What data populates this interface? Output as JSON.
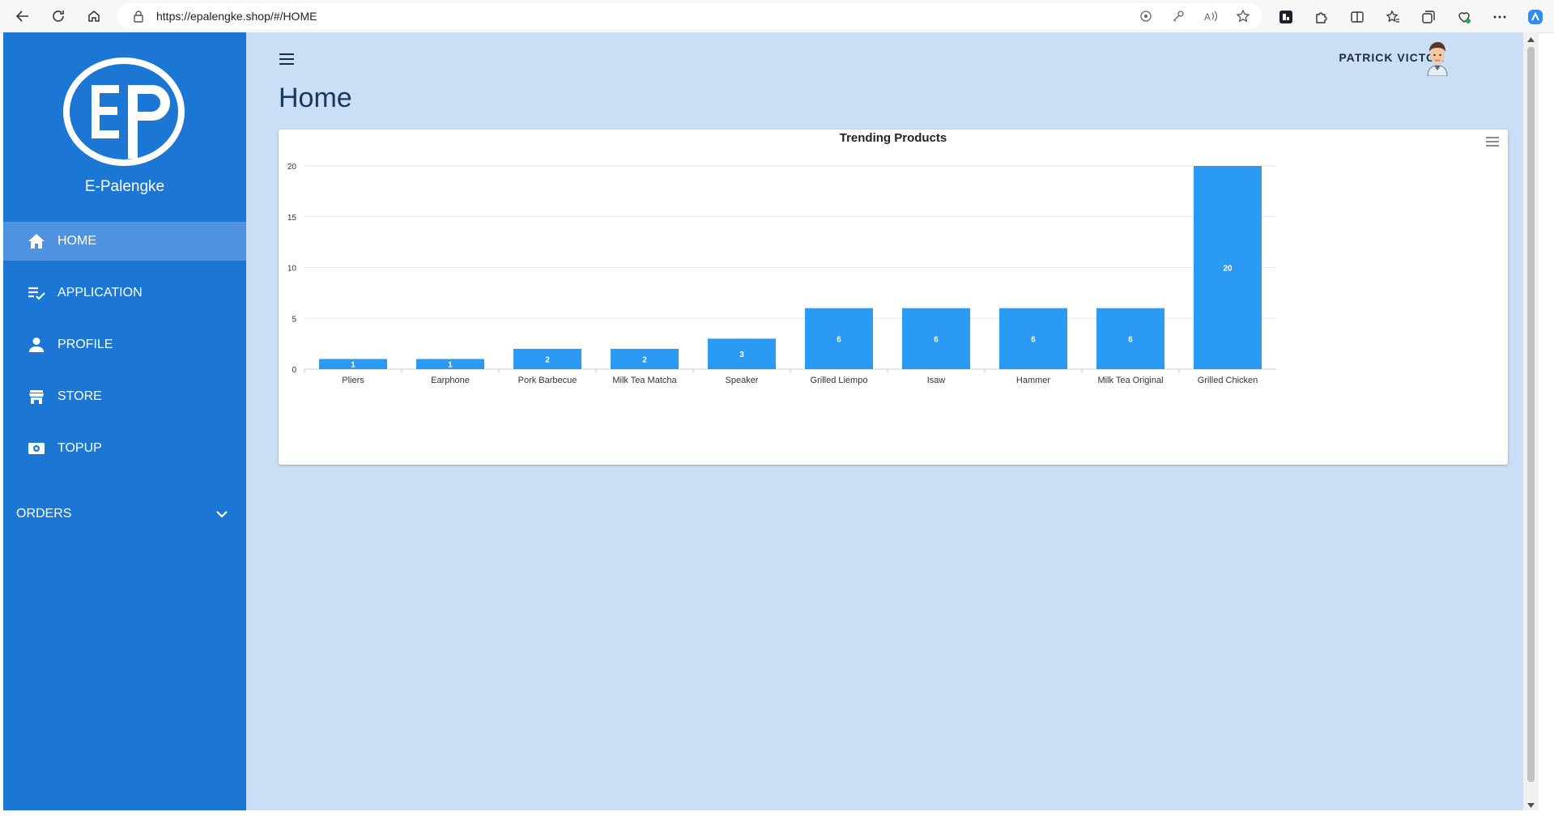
{
  "browser": {
    "url": "https://epalengke.shop/#/HOME"
  },
  "sidebar": {
    "brand": "E-Palengke",
    "items": [
      {
        "label": "HOME",
        "icon": "home-icon",
        "active": true
      },
      {
        "label": "APPLICATION",
        "icon": "playlist-check-icon",
        "active": false
      },
      {
        "label": "PROFILE",
        "icon": "person-icon",
        "active": false
      },
      {
        "label": "STORE",
        "icon": "store-icon",
        "active": false
      },
      {
        "label": "TOPUP",
        "icon": "cash-icon",
        "active": false
      }
    ],
    "orders_label": "ORDERS"
  },
  "header": {
    "user_name": "PATRICK VICTOR"
  },
  "main": {
    "title": "Home"
  },
  "colors": {
    "sidebar": "#1b76d4",
    "sidebar_active": "#4f93e0",
    "background": "#cadff5",
    "bar": "#2a9af5"
  },
  "chart_data": {
    "type": "bar",
    "title": "Trending Products",
    "categories": [
      "Pliers",
      "Earphone",
      "Pork Barbecue",
      "Milk Tea Matcha",
      "Speaker",
      "Grilled Liempo",
      "Isaw",
      "Hammer",
      "Milk Tea Original",
      "Grilled Chicken"
    ],
    "values": [
      1,
      1,
      2,
      2,
      3,
      6,
      6,
      6,
      6,
      20
    ],
    "yticks": [
      0,
      5,
      10,
      15,
      20
    ],
    "ylim": [
      0,
      20
    ],
    "xlabel": "",
    "ylabel": "",
    "grid": true,
    "data_labels": true
  }
}
